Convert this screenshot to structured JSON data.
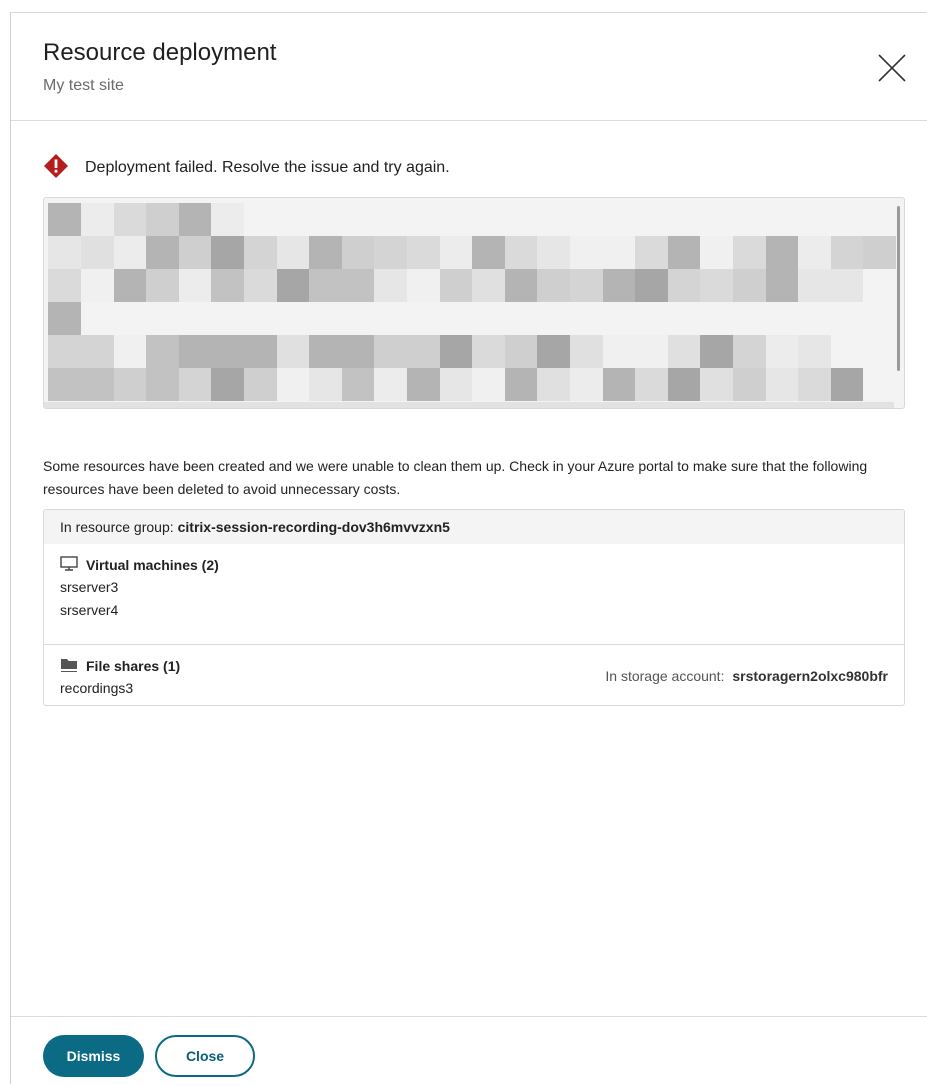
{
  "header": {
    "title": "Resource deployment",
    "subtitle": "My test site",
    "close_icon": "close-icon"
  },
  "alert": {
    "icon": "error-diamond-icon",
    "color": "#b71c1c",
    "message": "Deployment failed. Resolve the issue and try again."
  },
  "log": {
    "pixelated": true,
    "scrollbar": "vertical"
  },
  "description": "Some resources have been created and we were unable to clean them up. Check in your Azure portal to make sure that the following resources have been deleted to avoid unnecessary costs.",
  "resources": {
    "group_label": "In resource group:",
    "group_name": "citrix-session-recording-dov3h6mvvzxn5",
    "virtual_machines": {
      "icon": "monitor-icon",
      "title": "Virtual machines (2)",
      "items": [
        "srserver3",
        "srserver4"
      ]
    },
    "file_shares": {
      "icon": "folder-icon",
      "title": "File shares (1)",
      "storage_label": "In storage account:",
      "storage_name": "srstoragern2olxc980bfr",
      "items": [
        "recordings3"
      ]
    }
  },
  "footer": {
    "dismiss_label": "Dismiss",
    "close_label": "Close",
    "accent": "#0b6b84"
  }
}
